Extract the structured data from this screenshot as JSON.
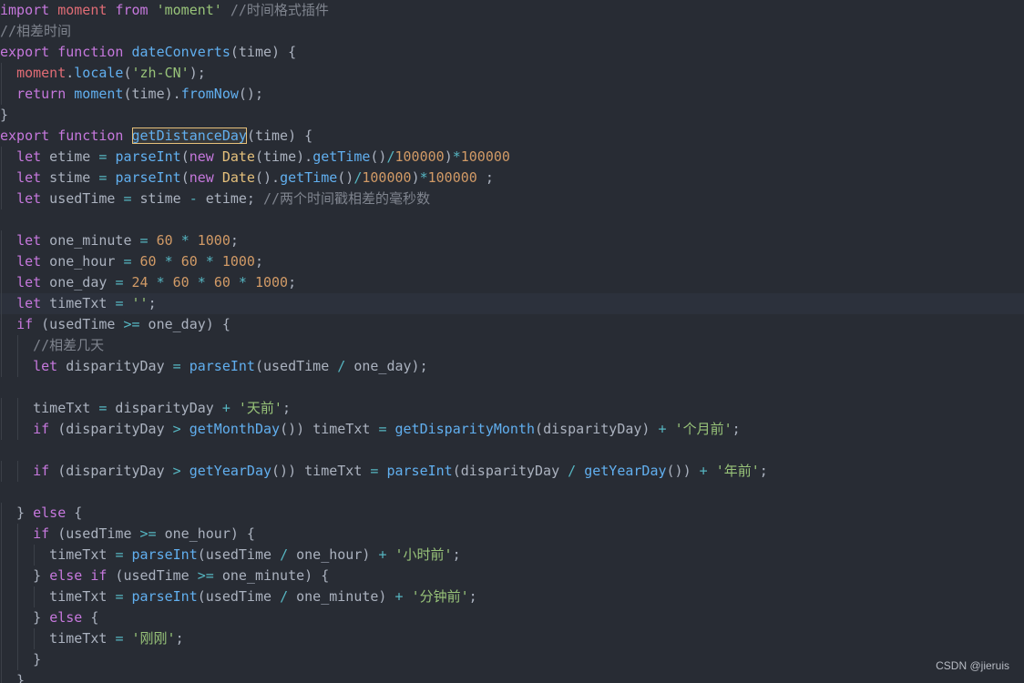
{
  "editor": {
    "theme_colors": {
      "background": "#282c34",
      "keyword": "#c678dd",
      "function": "#61afef",
      "string": "#98c379",
      "number": "#d19a66",
      "comment": "#7f848e",
      "variable": "#e06c75",
      "class": "#e5c07b",
      "operator": "#56b6c2",
      "text": "#abb2bf"
    },
    "current_line_index": 14,
    "lines": [
      [
        [
          "kw",
          "import"
        ],
        [
          "t",
          " "
        ],
        [
          "var",
          "moment"
        ],
        [
          "t",
          " "
        ],
        [
          "kw",
          "from"
        ],
        [
          "t",
          " "
        ],
        [
          "str",
          "'moment'"
        ],
        [
          "t",
          " "
        ],
        [
          "cmt",
          "//时间格式插件"
        ]
      ],
      [
        [
          "cmt",
          "//相差时间"
        ]
      ],
      [
        [
          "kw",
          "export"
        ],
        [
          "t",
          " "
        ],
        [
          "kw",
          "function"
        ],
        [
          "t",
          " "
        ],
        [
          "fn",
          "dateConverts"
        ],
        [
          "p",
          "("
        ],
        [
          "t",
          "time"
        ],
        [
          "p",
          ") {"
        ]
      ],
      [
        [
          "t",
          "  "
        ],
        [
          "var",
          "moment"
        ],
        [
          "p",
          "."
        ],
        [
          "fn",
          "locale"
        ],
        [
          "p",
          "("
        ],
        [
          "str",
          "'zh-CN'"
        ],
        [
          "p",
          ");"
        ]
      ],
      [
        [
          "t",
          "  "
        ],
        [
          "kw",
          "return"
        ],
        [
          "t",
          " "
        ],
        [
          "fn",
          "moment"
        ],
        [
          "p",
          "("
        ],
        [
          "t",
          "time"
        ],
        [
          "p",
          ")."
        ],
        [
          "fn",
          "fromNow"
        ],
        [
          "p",
          "();"
        ]
      ],
      [
        [
          "p",
          "}"
        ]
      ],
      [
        [
          "kw",
          "export"
        ],
        [
          "t",
          " "
        ],
        [
          "kw",
          "function"
        ],
        [
          "t",
          " "
        ],
        [
          "sel",
          "getDistanceDay"
        ],
        [
          "p",
          "("
        ],
        [
          "t",
          "time"
        ],
        [
          "p",
          ") {"
        ]
      ],
      [
        [
          "t",
          "  "
        ],
        [
          "kw",
          "let"
        ],
        [
          "t",
          " etime "
        ],
        [
          "op",
          "="
        ],
        [
          "t",
          " "
        ],
        [
          "fn",
          "parseInt"
        ],
        [
          "p",
          "("
        ],
        [
          "kw",
          "new"
        ],
        [
          "t",
          " "
        ],
        [
          "cls",
          "Date"
        ],
        [
          "p",
          "("
        ],
        [
          "t",
          "time"
        ],
        [
          "p",
          ")."
        ],
        [
          "fn",
          "getTime"
        ],
        [
          "p",
          "()"
        ],
        [
          "op",
          "/"
        ],
        [
          "num",
          "100000"
        ],
        [
          "p",
          ")"
        ],
        [
          "op",
          "*"
        ],
        [
          "num",
          "100000"
        ]
      ],
      [
        [
          "t",
          "  "
        ],
        [
          "kw",
          "let"
        ],
        [
          "t",
          " stime "
        ],
        [
          "op",
          "="
        ],
        [
          "t",
          " "
        ],
        [
          "fn",
          "parseInt"
        ],
        [
          "p",
          "("
        ],
        [
          "kw",
          "new"
        ],
        [
          "t",
          " "
        ],
        [
          "cls",
          "Date"
        ],
        [
          "p",
          "()."
        ],
        [
          "fn",
          "getTime"
        ],
        [
          "p",
          "()"
        ],
        [
          "op",
          "/"
        ],
        [
          "num",
          "100000"
        ],
        [
          "p",
          ")"
        ],
        [
          "op",
          "*"
        ],
        [
          "num",
          "100000"
        ],
        [
          "t",
          " ;"
        ]
      ],
      [
        [
          "t",
          "  "
        ],
        [
          "kw",
          "let"
        ],
        [
          "t",
          " usedTime "
        ],
        [
          "op",
          "="
        ],
        [
          "t",
          " stime "
        ],
        [
          "op",
          "-"
        ],
        [
          "t",
          " etime; "
        ],
        [
          "cmt",
          "//两个时间戳相差的毫秒数"
        ]
      ],
      [],
      [
        [
          "t",
          "  "
        ],
        [
          "kw",
          "let"
        ],
        [
          "t",
          " one_minute "
        ],
        [
          "op",
          "="
        ],
        [
          "t",
          " "
        ],
        [
          "num",
          "60"
        ],
        [
          "t",
          " "
        ],
        [
          "op",
          "*"
        ],
        [
          "t",
          " "
        ],
        [
          "num",
          "1000"
        ],
        [
          "p",
          ";"
        ]
      ],
      [
        [
          "t",
          "  "
        ],
        [
          "kw",
          "let"
        ],
        [
          "t",
          " one_hour "
        ],
        [
          "op",
          "="
        ],
        [
          "t",
          " "
        ],
        [
          "num",
          "60"
        ],
        [
          "t",
          " "
        ],
        [
          "op",
          "*"
        ],
        [
          "t",
          " "
        ],
        [
          "num",
          "60"
        ],
        [
          "t",
          " "
        ],
        [
          "op",
          "*"
        ],
        [
          "t",
          " "
        ],
        [
          "num",
          "1000"
        ],
        [
          "p",
          ";"
        ]
      ],
      [
        [
          "t",
          "  "
        ],
        [
          "kw",
          "let"
        ],
        [
          "t",
          " one_day "
        ],
        [
          "op",
          "="
        ],
        [
          "t",
          " "
        ],
        [
          "num",
          "24"
        ],
        [
          "t",
          " "
        ],
        [
          "op",
          "*"
        ],
        [
          "t",
          " "
        ],
        [
          "num",
          "60"
        ],
        [
          "t",
          " "
        ],
        [
          "op",
          "*"
        ],
        [
          "t",
          " "
        ],
        [
          "num",
          "60"
        ],
        [
          "t",
          " "
        ],
        [
          "op",
          "*"
        ],
        [
          "t",
          " "
        ],
        [
          "num",
          "1000"
        ],
        [
          "p",
          ";"
        ]
      ],
      [
        [
          "t",
          "  "
        ],
        [
          "kw",
          "let"
        ],
        [
          "t",
          " timeTxt "
        ],
        [
          "op",
          "="
        ],
        [
          "t",
          " "
        ],
        [
          "str",
          "''"
        ],
        [
          "p",
          ";"
        ]
      ],
      [
        [
          "t",
          "  "
        ],
        [
          "kw",
          "if"
        ],
        [
          "t",
          " (usedTime "
        ],
        [
          "op",
          ">="
        ],
        [
          "t",
          " one_day) {"
        ]
      ],
      [
        [
          "t",
          "    "
        ],
        [
          "cmt",
          "//相差几天"
        ]
      ],
      [
        [
          "t",
          "    "
        ],
        [
          "kw",
          "let"
        ],
        [
          "t",
          " disparityDay "
        ],
        [
          "op",
          "="
        ],
        [
          "t",
          " "
        ],
        [
          "fn",
          "parseInt"
        ],
        [
          "p",
          "("
        ],
        [
          "t",
          "usedTime "
        ],
        [
          "op",
          "/"
        ],
        [
          "t",
          " one_day);"
        ]
      ],
      [],
      [
        [
          "t",
          "    timeTxt "
        ],
        [
          "op",
          "="
        ],
        [
          "t",
          " disparityDay "
        ],
        [
          "op",
          "+"
        ],
        [
          "t",
          " "
        ],
        [
          "str",
          "'天前'"
        ],
        [
          "p",
          ";"
        ]
      ],
      [
        [
          "t",
          "    "
        ],
        [
          "kw",
          "if"
        ],
        [
          "t",
          " (disparityDay "
        ],
        [
          "op",
          ">"
        ],
        [
          "t",
          " "
        ],
        [
          "fn",
          "getMonthDay"
        ],
        [
          "p",
          "()) "
        ],
        [
          "t",
          "timeTxt "
        ],
        [
          "op",
          "="
        ],
        [
          "t",
          " "
        ],
        [
          "fn",
          "getDisparityMonth"
        ],
        [
          "p",
          "("
        ],
        [
          "t",
          "disparityDay) "
        ],
        [
          "op",
          "+"
        ],
        [
          "t",
          " "
        ],
        [
          "str",
          "'个月前'"
        ],
        [
          "p",
          ";"
        ]
      ],
      [],
      [
        [
          "t",
          "    "
        ],
        [
          "kw",
          "if"
        ],
        [
          "t",
          " (disparityDay "
        ],
        [
          "op",
          ">"
        ],
        [
          "t",
          " "
        ],
        [
          "fn",
          "getYearDay"
        ],
        [
          "p",
          "()) "
        ],
        [
          "t",
          "timeTxt "
        ],
        [
          "op",
          "="
        ],
        [
          "t",
          " "
        ],
        [
          "fn",
          "parseInt"
        ],
        [
          "p",
          "("
        ],
        [
          "t",
          "disparityDay "
        ],
        [
          "op",
          "/"
        ],
        [
          "t",
          " "
        ],
        [
          "fn",
          "getYearDay"
        ],
        [
          "p",
          "()) "
        ],
        [
          "op",
          "+"
        ],
        [
          "t",
          " "
        ],
        [
          "str",
          "'年前'"
        ],
        [
          "p",
          ";"
        ]
      ],
      [],
      [
        [
          "t",
          "  } "
        ],
        [
          "kw",
          "else"
        ],
        [
          "t",
          " {"
        ]
      ],
      [
        [
          "t",
          "    "
        ],
        [
          "kw",
          "if"
        ],
        [
          "t",
          " (usedTime "
        ],
        [
          "op",
          ">="
        ],
        [
          "t",
          " one_hour) {"
        ]
      ],
      [
        [
          "t",
          "      timeTxt "
        ],
        [
          "op",
          "="
        ],
        [
          "t",
          " "
        ],
        [
          "fn",
          "parseInt"
        ],
        [
          "p",
          "("
        ],
        [
          "t",
          "usedTime "
        ],
        [
          "op",
          "/"
        ],
        [
          "t",
          " one_hour) "
        ],
        [
          "op",
          "+"
        ],
        [
          "t",
          " "
        ],
        [
          "str",
          "'小时前'"
        ],
        [
          "p",
          ";"
        ]
      ],
      [
        [
          "t",
          "    } "
        ],
        [
          "kw",
          "else"
        ],
        [
          "t",
          " "
        ],
        [
          "kw",
          "if"
        ],
        [
          "t",
          " (usedTime "
        ],
        [
          "op",
          ">="
        ],
        [
          "t",
          " one_minute) {"
        ]
      ],
      [
        [
          "t",
          "      timeTxt "
        ],
        [
          "op",
          "="
        ],
        [
          "t",
          " "
        ],
        [
          "fn",
          "parseInt"
        ],
        [
          "p",
          "("
        ],
        [
          "t",
          "usedTime "
        ],
        [
          "op",
          "/"
        ],
        [
          "t",
          " one_minute) "
        ],
        [
          "op",
          "+"
        ],
        [
          "t",
          " "
        ],
        [
          "str",
          "'分钟前'"
        ],
        [
          "p",
          ";"
        ]
      ],
      [
        [
          "t",
          "    } "
        ],
        [
          "kw",
          "else"
        ],
        [
          "t",
          " {"
        ]
      ],
      [
        [
          "t",
          "      timeTxt "
        ],
        [
          "op",
          "="
        ],
        [
          "t",
          " "
        ],
        [
          "str",
          "'刚刚'"
        ],
        [
          "p",
          ";"
        ]
      ],
      [
        [
          "t",
          "    }"
        ]
      ],
      [
        [
          "t",
          "  }"
        ]
      ]
    ]
  },
  "watermark": {
    "text": "CSDN @jieruis"
  }
}
